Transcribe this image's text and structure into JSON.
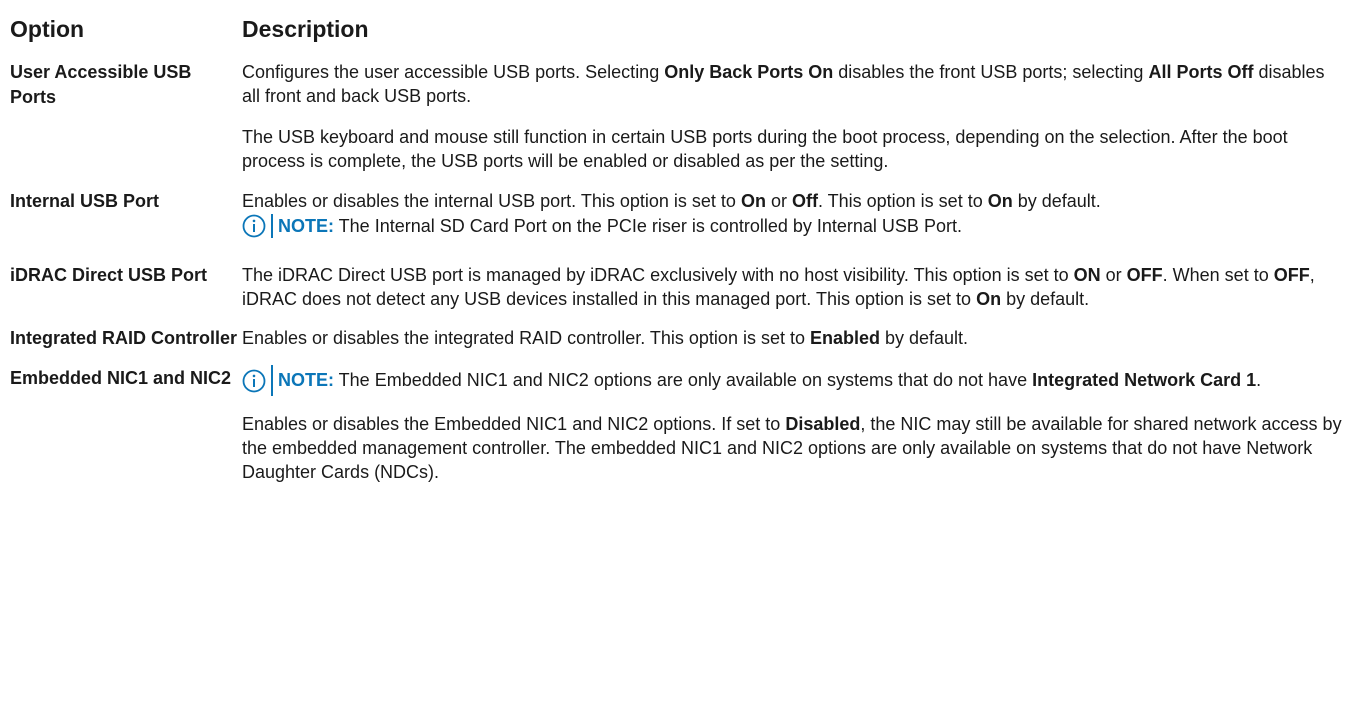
{
  "header": {
    "option": "Option",
    "description": "Description"
  },
  "rows": {
    "user_usb": {
      "option": "User Accessible USB Ports",
      "p1_a": "Configures the user accessible USB ports. Selecting ",
      "p1_b": "Only Back Ports On",
      "p1_c": " disables the front USB ports; selecting ",
      "p1_d": "All Ports Off",
      "p1_e": " disables all front and back USB ports.",
      "p2": "The USB keyboard and mouse still function in certain USB ports during the boot process, depending on the selection. After the boot process is complete, the USB ports will be enabled or disabled as per the setting."
    },
    "internal_usb": {
      "option": "Internal USB Port",
      "p1_a": "Enables or disables the internal USB port. This option is set to ",
      "p1_b": "On",
      "p1_c": " or ",
      "p1_d": "Off",
      "p1_e": ". This option is set to ",
      "p1_f": "On",
      "p1_g": " by default.",
      "note_label": "NOTE:",
      "note_text": " The Internal SD Card Port on the PCIe riser is controlled by Internal USB Port."
    },
    "idrac": {
      "option": "iDRAC Direct USB Port",
      "t1": "The iDRAC Direct USB port is managed by iDRAC exclusively with no host visibility. This option is set to ",
      "t2": "ON",
      "t3": " or ",
      "t4": "OFF",
      "t5": ". When set to ",
      "t6": "OFF",
      "t7": ", iDRAC does not detect any USB devices installed in this managed port. This option is set to ",
      "t8": "On",
      "t9": " by default."
    },
    "raid": {
      "option": "Integrated RAID Controller",
      "t1": "Enables or disables the integrated RAID controller. This option is set to ",
      "t2": "Enabled",
      "t3": " by default."
    },
    "nic": {
      "option": "Embedded NIC1 and NIC2",
      "note_label": "NOTE:",
      "note_text": " The Embedded NIC1 and NIC2 options are only available on systems that do not have ",
      "note_bold": "Integrated Network Card 1",
      "note_end": ".",
      "t1": "Enables or disables the Embedded NIC1 and NIC2 options. If set to ",
      "t2": "Disabled",
      "t3": ", the NIC may still be available for shared network access by the embedded management controller. The embedded NIC1 and NIC2 options are only available on systems that do not have Network Daughter Cards (NDCs)."
    }
  },
  "colors": {
    "note_accent": "#0b76b8",
    "text": "#1a1a1a"
  }
}
